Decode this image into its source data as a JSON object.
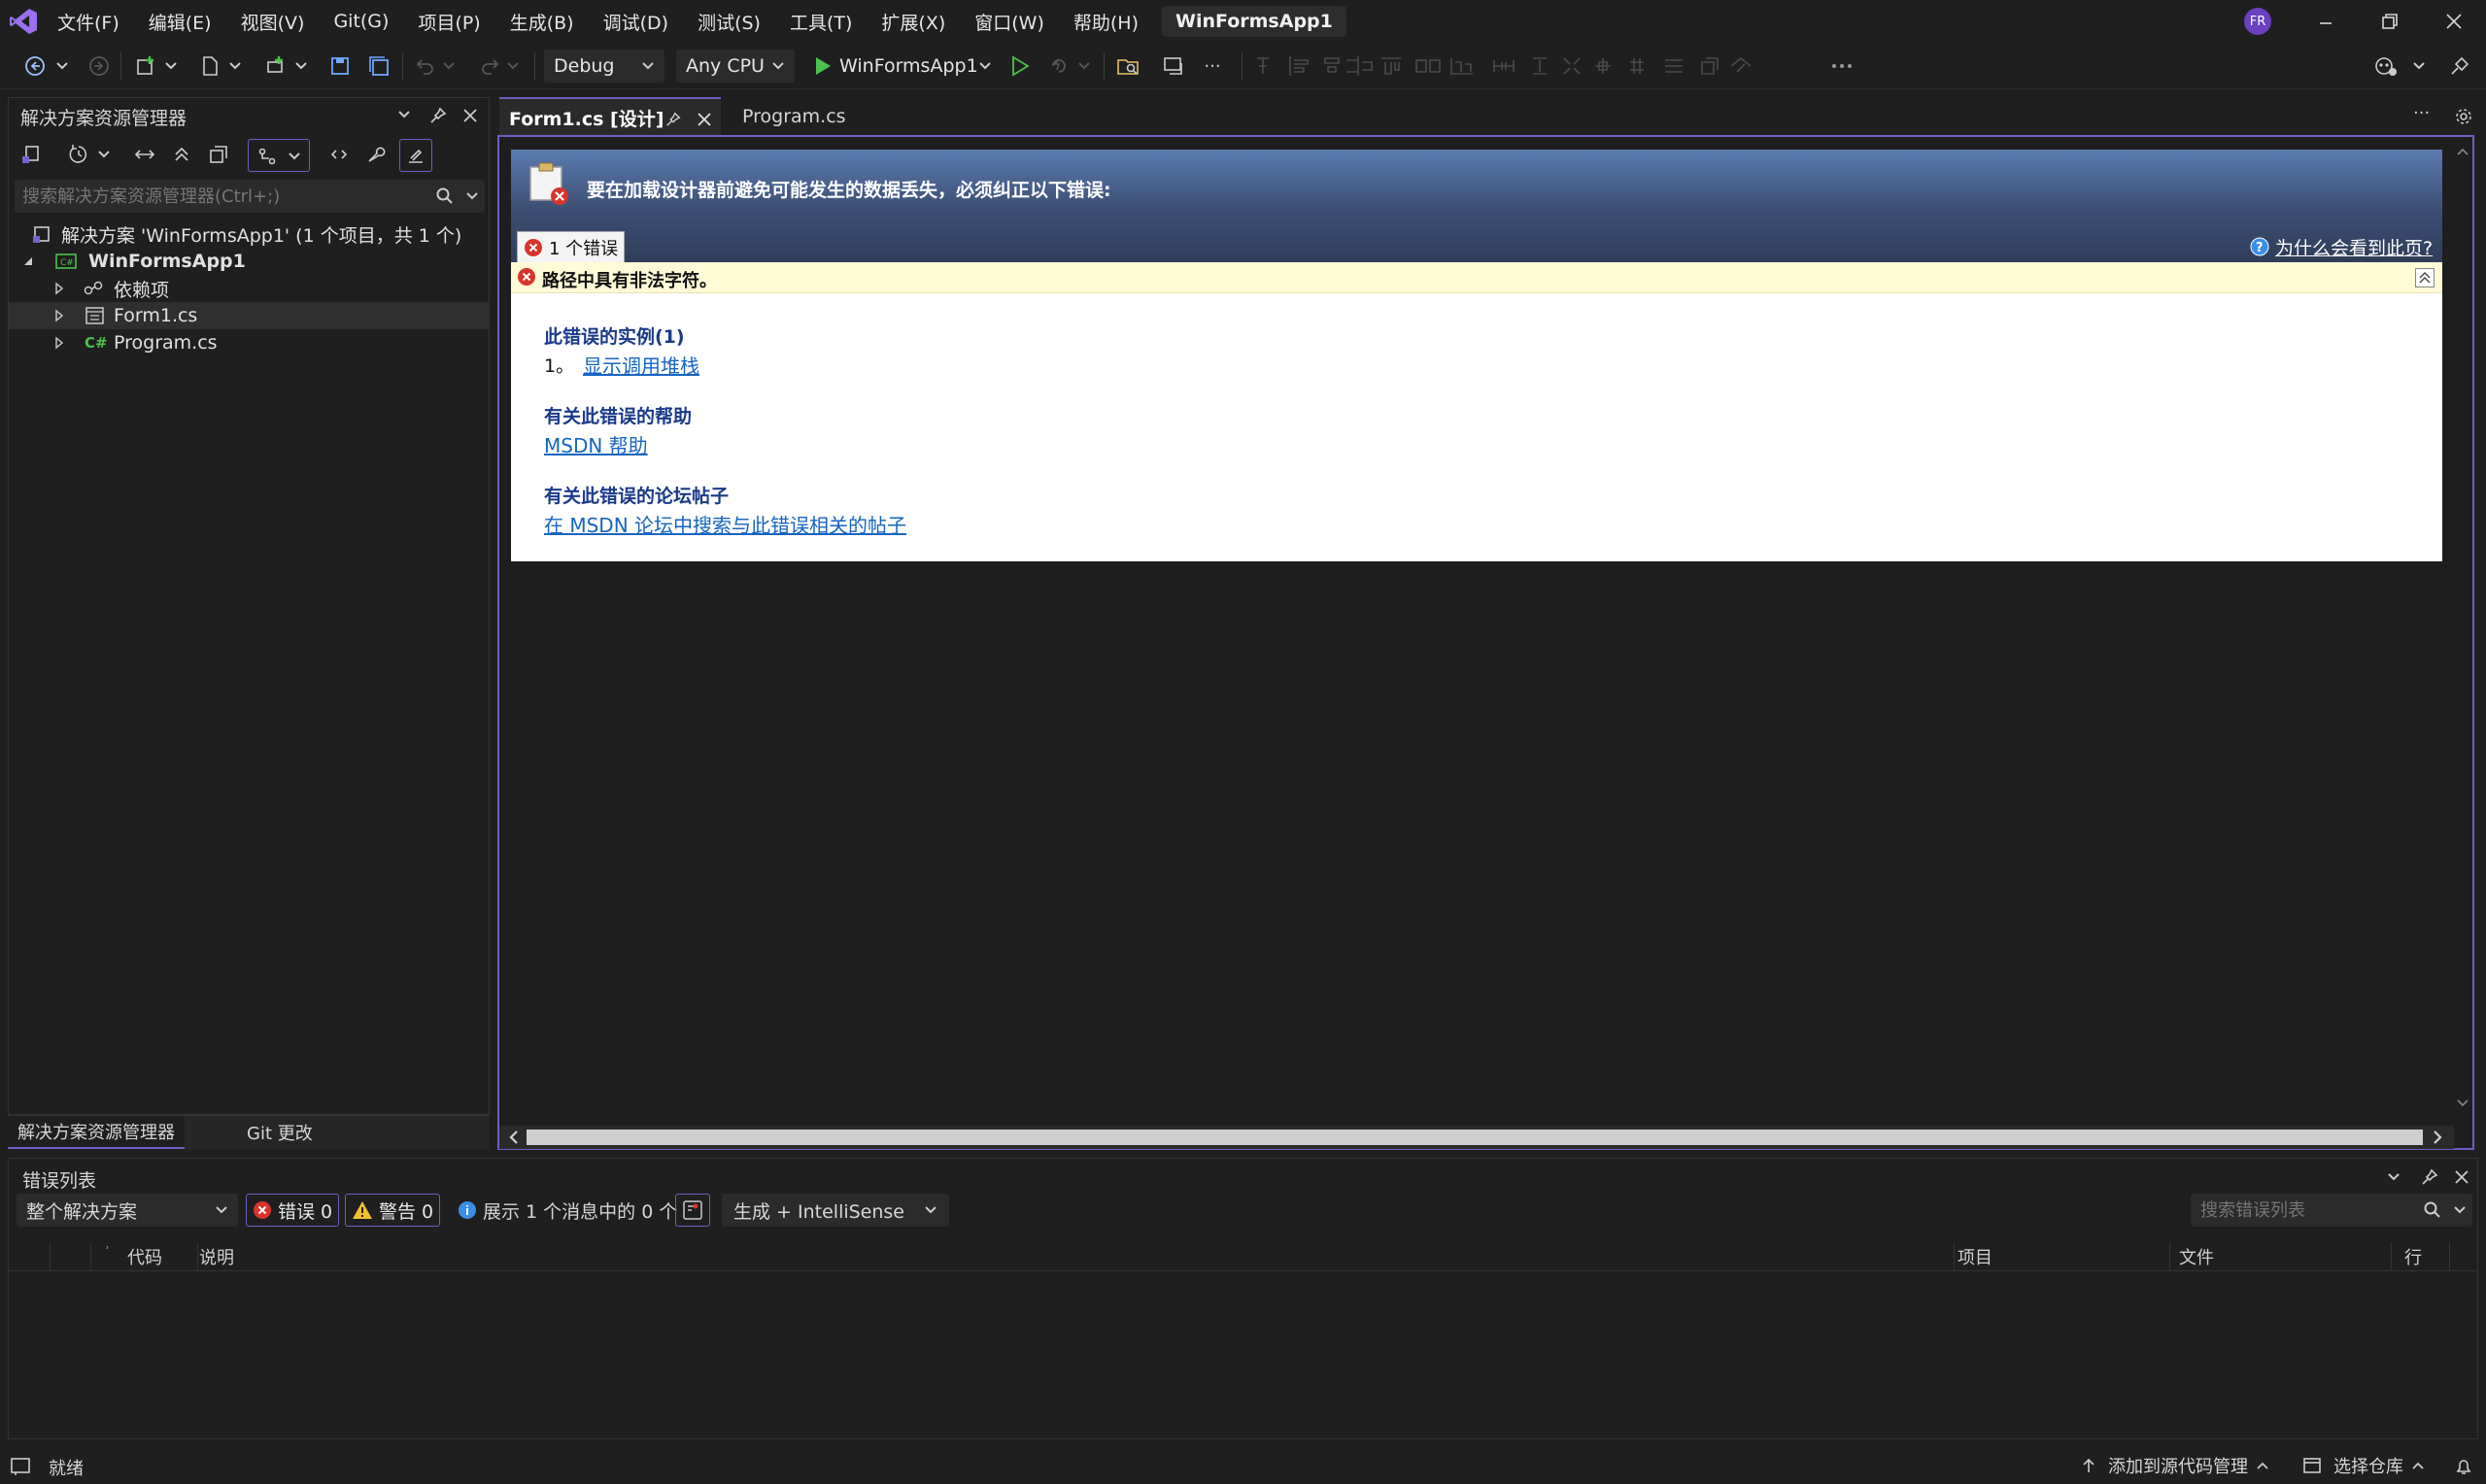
{
  "titlebar": {
    "menus": [
      "文件(F)",
      "编辑(E)",
      "视图(V)",
      "Git(G)",
      "项目(P)",
      "生成(B)",
      "调试(D)",
      "测试(S)",
      "工具(T)",
      "扩展(X)",
      "窗口(W)",
      "帮助(H)"
    ],
    "search_label": "搜索",
    "solution_title": "WinFormsApp1",
    "avatar": "FR"
  },
  "toolbar": {
    "config": "Debug",
    "platform": "Any CPU",
    "start_label": "WinFormsApp1",
    "more": "···"
  },
  "solution_explorer": {
    "title": "解决方案资源管理器",
    "search_placeholder": "搜索解决方案资源管理器(Ctrl+;)",
    "tree": {
      "solution": "解决方案 'WinFormsApp1' (1 个项目，共 1 个)",
      "project": "WinFormsApp1",
      "dependencies": "依赖项",
      "form1": "Form1.cs",
      "program": "Program.cs",
      "csharp_badge": "C#"
    },
    "bottom_tabs": [
      "解决方案资源管理器",
      "Git 更改"
    ]
  },
  "editor": {
    "tabs": [
      "Form1.cs [设计]",
      "Program.cs"
    ],
    "more": "···"
  },
  "designer_error": {
    "header_message": "要在加载设计器前避免可能发生的数据丢失，必须纠正以下错误:",
    "error_count_tab": "1 个错误",
    "why_link": "为什么会看到此页?",
    "error_text": "路径中具有非法字符。",
    "instances_title": "此错误的实例(1)",
    "instance_index": "1。",
    "show_stack_link": "显示调用堆栈",
    "help_title": "有关此错误的帮助",
    "msdn_link": "MSDN 帮助",
    "forum_title": "有关此错误的论坛帖子",
    "forum_link": "在 MSDN 论坛中搜索与此错误相关的帖子"
  },
  "error_list": {
    "title": "错误列表",
    "scope": "整个解决方案",
    "errors_btn": "错误 0",
    "warnings_btn": "警告 0",
    "messages": "展示 1 个消息中的 0 个",
    "build_filter": "生成 + IntelliSense",
    "search_placeholder": "搜索错误列表",
    "columns": [
      "代码",
      "说明",
      "项目",
      "文件",
      "行"
    ]
  },
  "statusbar": {
    "ready": "就绪",
    "add_source": "添加到源代码管理",
    "select_repo": "选择仓库"
  },
  "colors": {
    "accent": "#6b5fc5",
    "play_green": "#4cc24c",
    "error_red": "#d9342b",
    "link_blue": "#1565c0"
  }
}
